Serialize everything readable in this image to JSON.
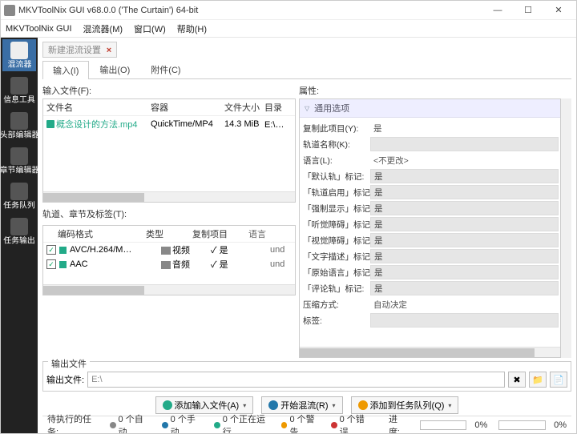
{
  "window": {
    "title": "MKVToolNix GUI v68.0.0 ('The Curtain') 64-bit"
  },
  "menubar": {
    "app": "MKVToolNix GUI",
    "mux": "混流器(M)",
    "window": "窗口(W)",
    "help": "帮助(H)"
  },
  "sidebar": {
    "items": [
      {
        "label": "混流器"
      },
      {
        "label": "信息工具"
      },
      {
        "label": "头部编辑器"
      },
      {
        "label": "章节编辑器"
      },
      {
        "label": "任务队列"
      },
      {
        "label": "任务输出"
      }
    ]
  },
  "doc_tab": {
    "label": "新建混流设置",
    "close": "×"
  },
  "sub_tabs": {
    "input": "输入(I)",
    "output": "输出(O)",
    "attach": "附件(C)"
  },
  "input": {
    "files_label": "输入文件(F):",
    "cols": {
      "name": "文件名",
      "container": "容器",
      "size": "文件大小",
      "dir": "目录"
    },
    "file": {
      "name": "概念设计的方法.mp4",
      "container": "QuickTime/MP4",
      "size": "14.3 MiB",
      "dir": "E:\\大教程\\"
    },
    "tracks_label": "轨道、章节及标签(T):",
    "tcols": {
      "codec": "编码格式",
      "type": "类型",
      "copy": "复制项目",
      "lang": "语言"
    },
    "tracks": [
      {
        "codec": "AVC/H.264/M…",
        "type": "视频",
        "copy": "是",
        "lang": "und"
      },
      {
        "codec": "AAC",
        "type": "音频",
        "copy": "是",
        "lang": "und"
      }
    ]
  },
  "props": {
    "header": "通用选项",
    "rows": {
      "copy": {
        "label": "复制此项目(Y):",
        "value": "是"
      },
      "trackname": {
        "label": "轨道名称(K):",
        "value": ""
      },
      "language": {
        "label": "语言(L):",
        "value": "<不更改>"
      },
      "default": {
        "label": "「默认轨」标记:",
        "value": "是"
      },
      "enabled": {
        "label": "「轨道启用」标记:",
        "value": "是"
      },
      "forced": {
        "label": "「强制显示」标记:",
        "value": "是"
      },
      "hearing": {
        "label": "「听觉障碍」标记:",
        "value": "是"
      },
      "visual": {
        "label": "「视觉障碍」标记:",
        "value": "是"
      },
      "text": {
        "label": "「文字描述」标记:",
        "value": "是"
      },
      "orig": {
        "label": "「原始语言」标记:",
        "value": "是"
      },
      "comment": {
        "label": "「评论轨」标记:",
        "value": "是"
      },
      "compress": {
        "label": "压缩方式:",
        "value": "自动决定"
      },
      "tags": {
        "label": "标签:",
        "value": ""
      }
    }
  },
  "output": {
    "legend": "输出文件",
    "label": "输出文件:",
    "value": "E:\\"
  },
  "actions": {
    "add": "添加输入文件(A)",
    "start": "开始混流(R)",
    "queue": "添加到任务队列(Q)"
  },
  "status": {
    "pending_label": "待执行的任务:",
    "auto": "0 个自动,",
    "manual": "0 个手动,",
    "running": "0 个正在运行",
    "warn": "0 个警告",
    "err": "0 个错误",
    "progress": "进度:",
    "p1": "0%",
    "p2": "0%"
  },
  "icons": {
    "check": "✓",
    "down": "▾",
    "tri": "▽",
    "play": "▶"
  }
}
